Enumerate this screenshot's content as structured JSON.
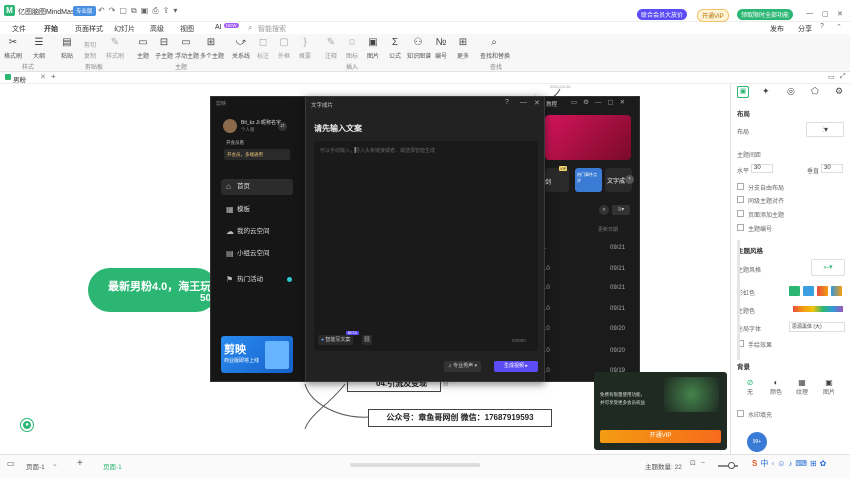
{
  "app": {
    "title": "亿图脑图MindMaster",
    "badge": "专业版",
    "promo1": "联合会员大放价",
    "promo2": "开通VIP",
    "promo3": "领取限时全部功能",
    "window_controls": [
      "—",
      "▢",
      "✕"
    ]
  },
  "menubar": {
    "items": [
      "文件",
      "开始",
      "页面样式",
      "幻灯片",
      "高级",
      "视图",
      "AI",
      "智能搜索"
    ],
    "ai_badge": "NEW",
    "right_items": [
      "发布",
      "分享"
    ]
  },
  "ribbon": {
    "tools": [
      {
        "label": "格式刷",
        "icon": "✂"
      },
      {
        "label": "大纲",
        "icon": "☰"
      },
      {
        "label": "粘贴",
        "icon": "📋"
      },
      {
        "label": "剪切",
        "icon": "✂"
      },
      {
        "label": "复制",
        "icon": "⧉"
      },
      {
        "label": "样式刷",
        "icon": "✎"
      },
      {
        "label": "主题",
        "icon": "▭"
      },
      {
        "label": "子主题",
        "icon": "⊟"
      },
      {
        "label": "浮动主题",
        "icon": "▭"
      },
      {
        "label": "多个主题",
        "icon": "⊞"
      },
      {
        "label": "关系线",
        "icon": "⤻"
      },
      {
        "label": "标注",
        "icon": "◻"
      },
      {
        "label": "外框",
        "icon": "▢"
      },
      {
        "label": "概要",
        "icon": "}"
      },
      {
        "label": "注释",
        "icon": "✎"
      },
      {
        "label": "图标",
        "icon": "☺"
      },
      {
        "label": "图片",
        "icon": "🖼"
      },
      {
        "label": "公式",
        "icon": "Σ"
      },
      {
        "label": "知识图谱",
        "icon": "⚇"
      },
      {
        "label": "编号",
        "icon": "№"
      },
      {
        "label": "更多",
        "icon": "⋯"
      },
      {
        "label": "查找和替换",
        "icon": "⌕"
      }
    ],
    "groups": [
      "样式",
      "剪贴板",
      "主题",
      "插入",
      "查找"
    ]
  },
  "doc_tabs": {
    "active": "男粉"
  },
  "canvas": {
    "main_node": "最新男粉4.0，海王玩",
    "main_node_suffix": "50",
    "node_sub": "04.引流及变现",
    "node_contact": "公众号：章鱼哥网创  微信：17687919593",
    "top_date": "2024-04-26"
  },
  "jianying": {
    "title": "剪映",
    "username": "Bit_kz Ji 昵称名字",
    "user_sub": "个人版",
    "vip_line": "开会员看",
    "vip_btn": "开会员，多端通用",
    "nav": [
      {
        "label": "首页",
        "icon": "⌂"
      },
      {
        "label": "模板",
        "icon": "▦"
      },
      {
        "label": "我的云空间",
        "icon": "☁"
      },
      {
        "label": "小组云空间",
        "icon": "▤"
      },
      {
        "label": "热门活动",
        "icon": "⚑"
      }
    ],
    "banner_title": "剪映",
    "banner_sub": "商业版即将上线",
    "right_title": "教程",
    "card_label1": "剑",
    "card_label2": "文字成",
    "card_label3": "热门事件点评",
    "row_numbers": [
      "1",
      "10",
      "10",
      "10",
      "10",
      "10",
      "10"
    ],
    "dates": [
      "09/21",
      "09/21",
      "09/21",
      "09/21",
      "09/20",
      "09/20",
      "09/19"
    ],
    "header_date": "更新日期"
  },
  "text_dialog": {
    "title": "文字成片",
    "heading": "请先输入文案",
    "placeholder": "可以手动输入，导入头条链接或者、或选择智能生成",
    "ai_button": "智能写文案",
    "ai_badge": "BETA",
    "counter": "0/2000",
    "voice_button": "专业男声",
    "generate_button": "生成视频"
  },
  "right_panel": {
    "tabs": [
      "layout",
      "style",
      "location",
      "icon",
      "settings"
    ],
    "section_layout": "布局",
    "layout_label": "布局",
    "theme_spacing": "主题间距",
    "horizontal_label": "水平",
    "horizontal_value": "30",
    "vertical_label": "垂直",
    "vertical_value": "30",
    "checks": [
      "分支自由布局",
      "同级主题对齐",
      "页面添加主题",
      "主题编号"
    ],
    "section_style": "主题风格",
    "theme_style_label": "主题风格",
    "color_label": "彩虹色",
    "theme_color_label": "主题色",
    "font_label": "全局字体",
    "font_value": "思源黑体 (大)",
    "hand_drawn": "手绘效果",
    "section_bg": "背景",
    "bg_options": [
      "无",
      "颜色",
      "纹理",
      "图片"
    ],
    "watermark": "水印填充"
  },
  "vip_popup": {
    "line1": "免费有限量使用功能，",
    "line2": "并可享受更多会员权益",
    "button": "开通VIP"
  },
  "statusbar": {
    "page": "页面-1",
    "add": "+",
    "active_page": "页面-1",
    "topic_count": "主题数量: 22",
    "zoom": "100%"
  },
  "colors": {
    "brand_green": "#2bb673",
    "dark": "#1e1e1e",
    "accent_blue": "#5b4cf5",
    "vip_orange": "#f39c12"
  }
}
